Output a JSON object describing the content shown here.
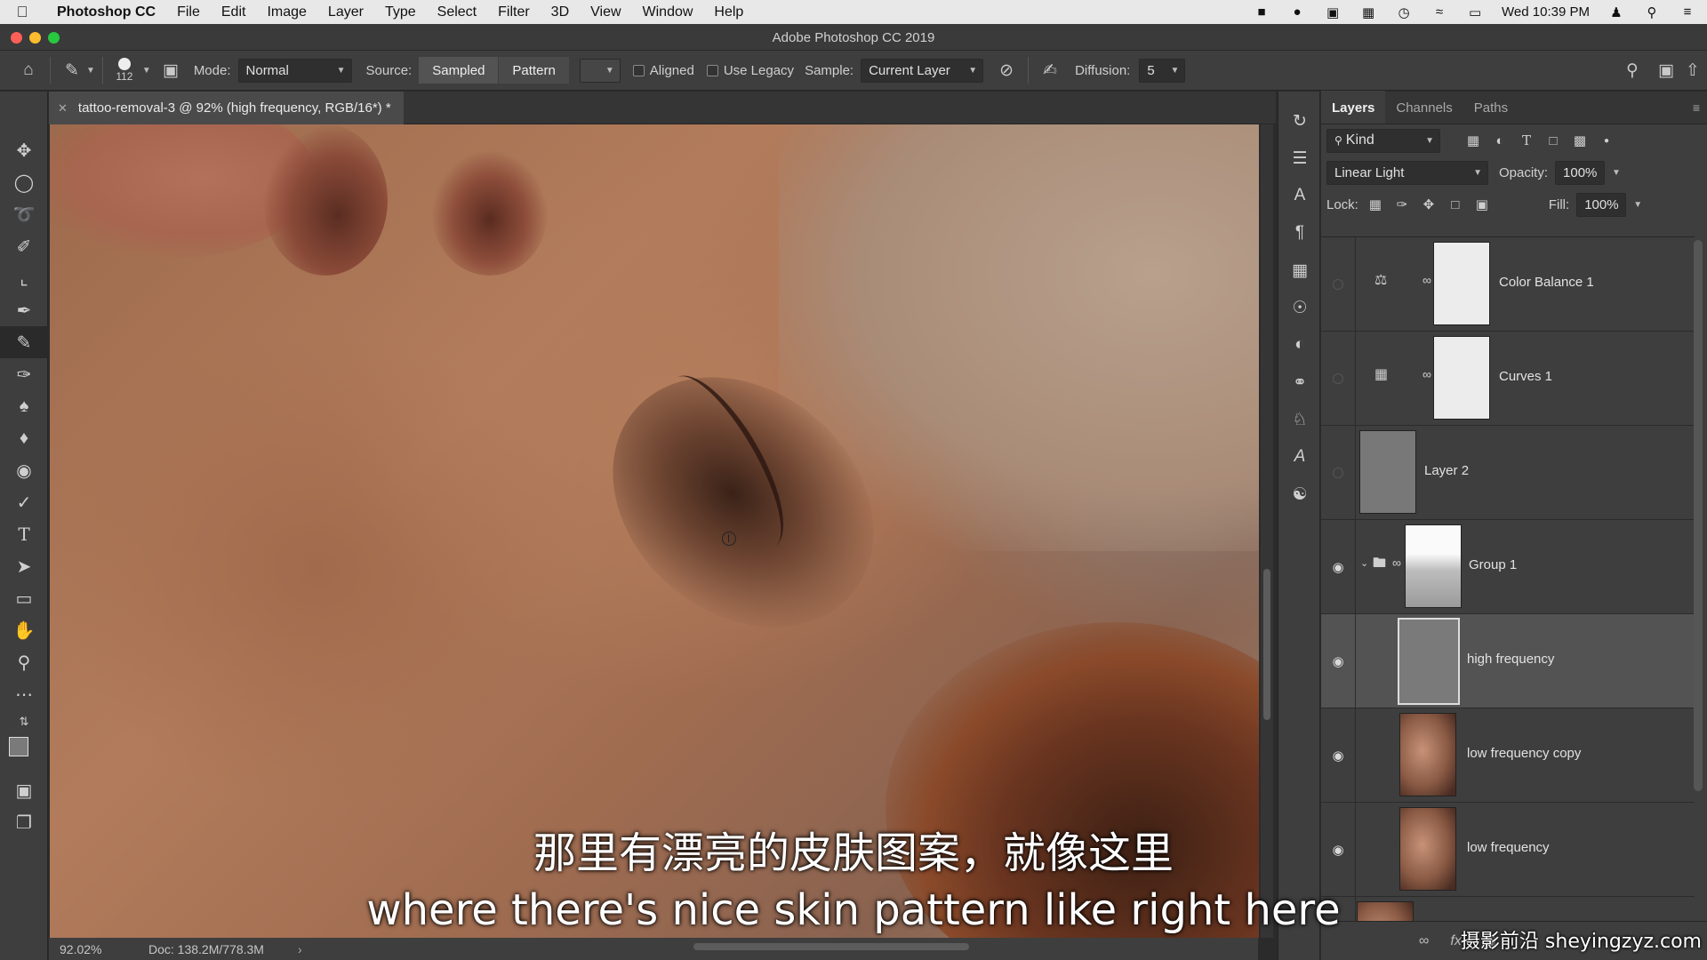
{
  "menubar": {
    "app": "Photoshop CC",
    "items": [
      "File",
      "Edit",
      "Image",
      "Layer",
      "Type",
      "Select",
      "Filter",
      "3D",
      "View",
      "Window",
      "Help"
    ],
    "clock": "Wed 10:39 PM"
  },
  "window": {
    "title": "Adobe Photoshop CC 2019"
  },
  "options": {
    "brush_size": "112",
    "mode_label": "Mode:",
    "mode_value": "Normal",
    "source_label": "Source:",
    "source_sampled": "Sampled",
    "source_pattern": "Pattern",
    "aligned": "Aligned",
    "use_legacy": "Use Legacy",
    "sample_label": "Sample:",
    "sample_value": "Current Layer",
    "diffusion_label": "Diffusion:",
    "diffusion_value": "5"
  },
  "document": {
    "tab_title": "tattoo-removal-3 @ 92% (high frequency, RGB/16*) *",
    "zoom": "92.02%",
    "doc_size": "Doc: 138.2M/778.3M"
  },
  "panel": {
    "tabs": [
      "Layers",
      "Channels",
      "Paths"
    ],
    "filter_kind": "Kind",
    "blend_mode": "Linear Light",
    "opacity_label": "Opacity:",
    "opacity_value": "100%",
    "lock_label": "Lock:",
    "fill_label": "Fill:",
    "fill_value": "100%",
    "layers": [
      {
        "name": "Color Balance 1",
        "visible": false,
        "type": "adjustment",
        "icon": "color-balance-icon"
      },
      {
        "name": "Curves 1",
        "visible": false,
        "type": "adjustment",
        "icon": "curves-icon"
      },
      {
        "name": "Layer 2",
        "visible": false,
        "type": "pixel"
      },
      {
        "name": "Group 1",
        "visible": true,
        "type": "group"
      },
      {
        "name": "high frequency",
        "visible": true,
        "type": "pixel",
        "selected": true
      },
      {
        "name": "low frequency copy",
        "visible": true,
        "type": "pixel"
      },
      {
        "name": "low frequency",
        "visible": true,
        "type": "pixel"
      }
    ]
  },
  "subtitles": {
    "zh": "那里有漂亮的皮肤图案，就像这里",
    "en": "where there's nice skin pattern like right here"
  },
  "watermark": "摄影前沿 sheyingzyz.com",
  "colors": {
    "traffic_red": "#fe5f57",
    "traffic_yellow": "#febc2e",
    "traffic_green": "#28c840",
    "panel_bg": "#3e3e3e",
    "selected_layer": "#535353"
  }
}
